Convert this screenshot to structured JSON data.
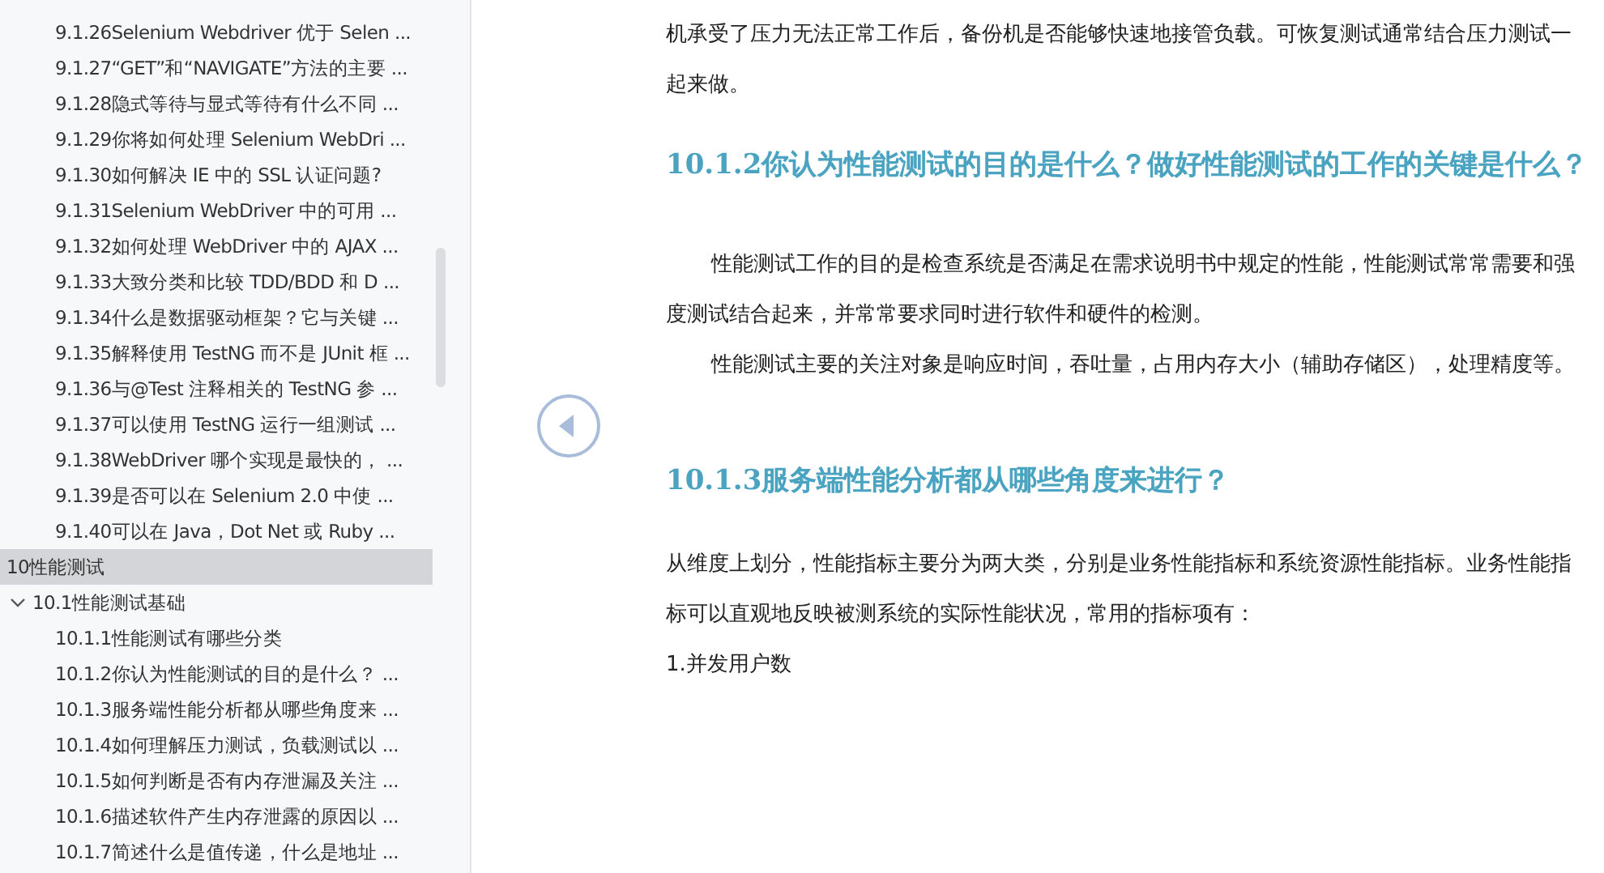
{
  "outline": {
    "cut_off_items": [
      {
        "label": "9.1.26Selenium Webdriver 优于 Selen ...",
        "selected": false
      },
      {
        "label": "9.1.27“GET”和“NAVIGATE”方法的主要 ...",
        "selected": false
      },
      {
        "label": "9.1.28隐式等待与显式等待有什么不同 ...",
        "selected": false
      },
      {
        "label": "9.1.29你将如何处理 Selenium WebDri ...",
        "selected": false
      },
      {
        "label": "9.1.30如何解决 IE 中的 SSL 认证问题?",
        "selected": false
      },
      {
        "label": "9.1.31Selenium WebDriver 中的可用 ...",
        "selected": false
      },
      {
        "label": "9.1.32如何处理 WebDriver 中的 AJAX ...",
        "selected": false
      },
      {
        "label": "9.1.33大致分类和比较 TDD/BDD 和 D ...",
        "selected": false
      },
      {
        "label": "9.1.34什么是数据驱动框架？它与关键 ...",
        "selected": false
      },
      {
        "label": "9.1.35解释使用 TestNG 而不是 JUnit 框 ...",
        "selected": false
      },
      {
        "label": "9.1.36与@Test 注释相关的 TestNG 参 ...",
        "selected": false
      },
      {
        "label": "9.1.37可以使用 TestNG 运行一组测试 ...",
        "selected": false
      },
      {
        "label": "9.1.38WebDriver 哪个实现是最快的，  ...",
        "selected": false
      },
      {
        "label": "9.1.39是否可以在 Selenium 2.0 中使 ...",
        "selected": false
      },
      {
        "label": "9.1.40可以在 Java，Dot Net 或 Ruby ...",
        "selected": false
      }
    ],
    "items": [
      {
        "label": "10性能测试",
        "selected": true,
        "children": [
          {
            "label": "10.1性能测试基础",
            "selected": false,
            "expanded": true,
            "children": [
              {
                "label": "10.1.1性能测试有哪些分类",
                "selected": false
              },
              {
                "label": "10.1.2你认为性能测试的目的是什么？ ...",
                "selected": false
              },
              {
                "label": "10.1.3服务端性能分析都从哪些角度来 ...",
                "selected": false
              },
              {
                "label": "10.1.4如何理解压力测试，负载测试以 ...",
                "selected": false
              },
              {
                "label": "10.1.5如何判断是否有内存泄漏及关注 ...",
                "selected": false
              },
              {
                "label": "10.1.6描述软件产生内存泄露的原因以 ...",
                "selected": false
              },
              {
                "label": "10.1.7简述什么是值传递，什么是地址 ...",
                "selected": false
              }
            ]
          }
        ]
      }
    ]
  },
  "document": {
    "blocks": [
      {
        "kind": "paragraph",
        "indent": false,
        "text": "机承受了压力无法正常工作后，备份机是否能够快速地接管负载。可恢复测试通常结合压力测试一起来做。"
      },
      {
        "kind": "heading",
        "text": "10.1.2你认为性能测试的目的是什么？做好性能测试的工作的关键是什么？"
      },
      {
        "kind": "paragraph",
        "indent": true,
        "text": "性能测试工作的目的是检查系统是否满足在需求说明书中规定的性能，性能测试常常需要和强度测试结合起来，并常常要求同时进行软件和硬件的检测。"
      },
      {
        "kind": "paragraph",
        "indent": true,
        "text": "性能测试主要的关注对象是响应时间，吞吐量，占用内存大小（辅助存储区），处理精度等。"
      },
      {
        "kind": "heading",
        "text": "10.1.3服务端性能分析都从哪些角度来进行？"
      },
      {
        "kind": "paragraph",
        "indent": false,
        "text": "从维度上划分，性能指标主要分为两大类，分别是业务性能指标和系统资源性能指标。业务性能指标可以直观地反映被测系统的实际性能状况，常用的指标项有："
      },
      {
        "kind": "paragraph",
        "indent": false,
        "text": "1.并发用户数"
      }
    ]
  }
}
